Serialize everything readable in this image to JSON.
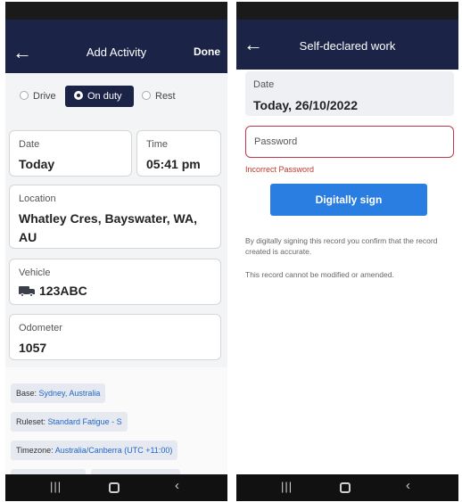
{
  "left_screen": {
    "header": {
      "title": "Add Activity",
      "back_icon": "arrow-left-icon",
      "done_label": "Done"
    },
    "activity_tabs": [
      {
        "label": "Drive",
        "selected": false
      },
      {
        "label": "On duty",
        "selected": true
      },
      {
        "label": "Rest",
        "selected": false
      }
    ],
    "date": {
      "label": "Date",
      "value": "Today"
    },
    "time": {
      "label": "Time",
      "value": "05:41 pm"
    },
    "location": {
      "label": "Location",
      "value": "Whatley Cres, Bayswater, WA, AU"
    },
    "vehicle": {
      "label": "Vehicle",
      "icon": "truck-icon",
      "value": "123ABC"
    },
    "odometer": {
      "label": "Odometer",
      "value": "1057"
    },
    "info_chips": {
      "base": {
        "label": "Base: ",
        "value": "Sydney, Australia"
      },
      "ruleset": {
        "label": "Ruleset: ",
        "value": "Standard Fatigue - S"
      },
      "timezone": {
        "label": "Timezone: ",
        "value": "Australia/Canberra (UTC +11:00)"
      }
    }
  },
  "right_screen": {
    "header": {
      "title": "Self-declared work",
      "back_icon": "arrow-left-icon"
    },
    "date": {
      "label": "Date",
      "value": "Today, 26/10/2022"
    },
    "password": {
      "placeholder": "Password",
      "error": "Incorrect Password"
    },
    "sign_button": "Digitally sign",
    "notes": [
      "By digitally signing this record you confirm that the record created is accurate.",
      "This record cannot be modified or amended."
    ]
  },
  "navigation_bar": {
    "recents_icon": "recents-icon",
    "home_icon": "home-icon",
    "back_icon": "back-chevron-icon"
  },
  "colors": {
    "header_bg": "#1b2447",
    "accent_blue": "#2a7de1",
    "error_red": "#c0394b",
    "link_blue": "#1f66c7"
  }
}
